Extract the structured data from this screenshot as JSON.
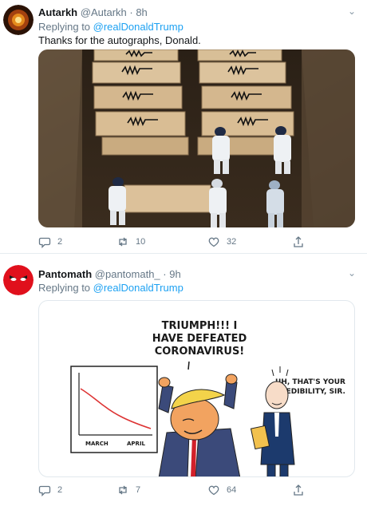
{
  "tweets": [
    {
      "author_name": "Autarkh",
      "author_handle": "@Autarkh",
      "time": "· 8h",
      "replying_prefix": "Replying to ",
      "replying_to": "@realDonaldTrump",
      "text": "Thanks for the autographs, Donald.",
      "replies": "2",
      "retweets": "10",
      "likes": "32"
    },
    {
      "author_name": "Pantomath",
      "author_handle": "@pantomath_",
      "time": "· 9h",
      "replying_prefix": "Replying to ",
      "replying_to": "@realDonaldTrump",
      "replies": "2",
      "retweets": "7",
      "likes": "64",
      "cartoon": {
        "speech_line1": "TRIUMPH!!! I",
        "speech_line2": "HAVE DEFEATED",
        "speech_line3": "CORONAVIRUS!",
        "reply_line1": "UH, THAT'S YOUR",
        "reply_line2": "CREDIBILITY, SIR.",
        "chart_x1": "MARCH",
        "chart_x2": "APRIL"
      }
    }
  ],
  "colors": {
    "link": "#1da1f2",
    "muted": "#657786",
    "avatar2": "#e0101c"
  },
  "icons": [
    "autarkh-avatar-icon",
    "angry-face-avatar-icon",
    "chevron-down-icon",
    "reply-icon",
    "retweet-icon",
    "like-icon",
    "share-icon"
  ]
}
